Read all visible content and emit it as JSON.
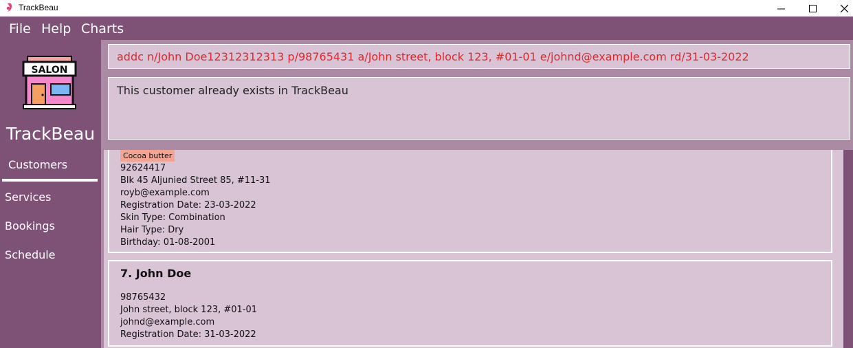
{
  "window": {
    "title": "TrackBeau"
  },
  "menu": [
    "File",
    "Help",
    "Charts"
  ],
  "sidebar": {
    "logo_text": "SALON",
    "brand": "TrackBeau",
    "items": [
      "Customers",
      "Services",
      "Bookings",
      "Schedule"
    ],
    "selected": "Customers"
  },
  "command": {
    "value": "addc n/John Doe12312312313 p/98765431 a/John street, block 123, #01-01 e/johnd@example.com rd/31-03-2022"
  },
  "result": {
    "message": "This customer already exists in TrackBeau"
  },
  "customers": [
    {
      "tag": "Cocoa butter",
      "phone": "92624417",
      "address": "Blk 45 Aljunied Street 85, #11-31",
      "email": "royb@example.com",
      "registration": "Registration Date: 23-03-2022",
      "skin": "Skin Type: Combination",
      "hair": "Hair Type: Dry",
      "birthday": "Birthday: 01-08-2001"
    },
    {
      "title": "7.  John Doe",
      "phone": "98765432",
      "address": "John street, block 123, #01-01",
      "email": "johnd@example.com",
      "registration": "Registration Date: 31-03-2022"
    }
  ],
  "colors": {
    "accent": "#7e5176",
    "panel": "#d9c4d6",
    "command_text": "#e0282c",
    "tag": "#f4a493"
  }
}
